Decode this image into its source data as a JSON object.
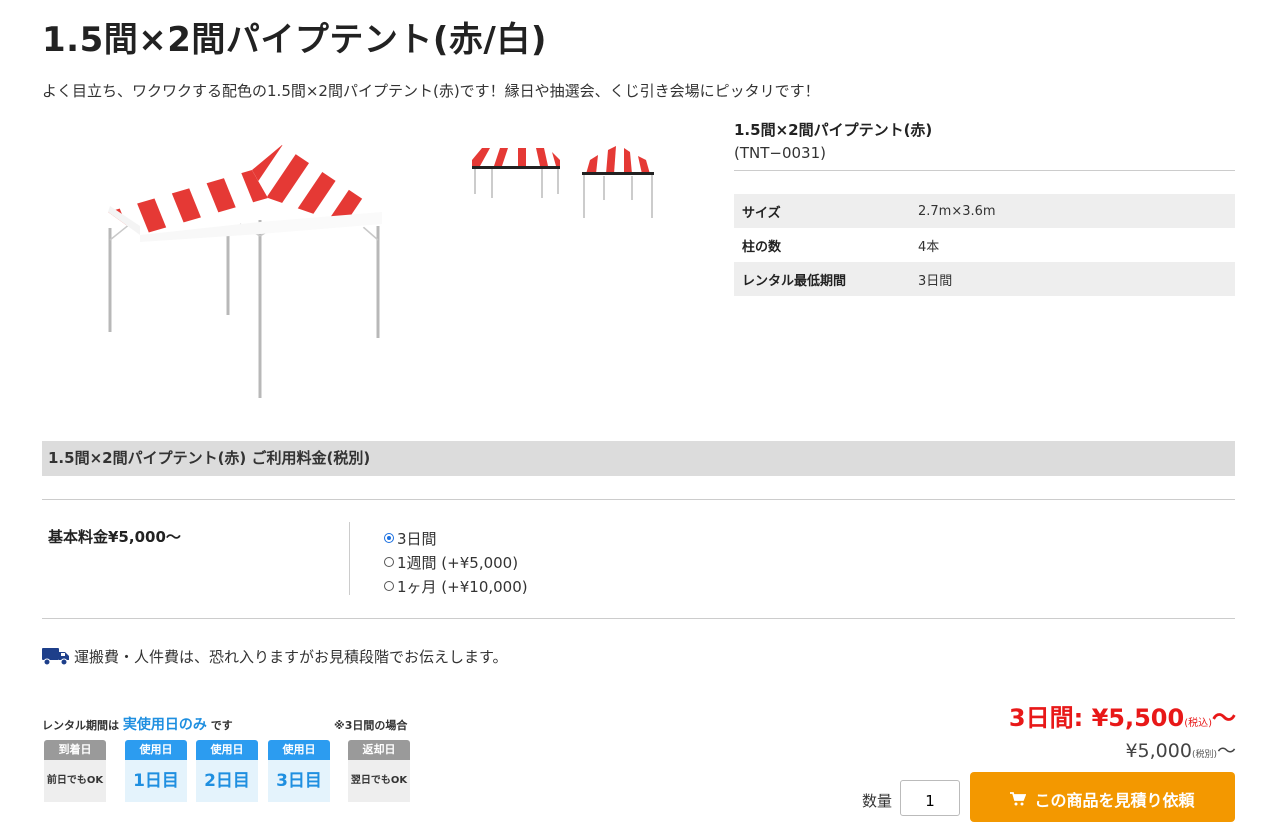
{
  "page": {
    "title": "1.5間×2間パイプテント(赤/白)",
    "lead": "よく目立ち、ワクワクする配色の1.5間×2間パイプテント(赤)です！縁日や抽選会、くじ引き会場にピッタリです！"
  },
  "product": {
    "name": "1.5間×2間パイプテント(赤)",
    "code": "(TNT−0031)",
    "specs": [
      {
        "key": "サイズ",
        "value": "2.7m×3.6m"
      },
      {
        "key": "柱の数",
        "value": "4本"
      },
      {
        "key": "レンタル最低期間",
        "value": "3日間"
      }
    ]
  },
  "pricing": {
    "header": "1.5間×2間パイプテント(赤) ご利用料金(税別)",
    "base_label": "基本料金¥5,000〜",
    "options": [
      {
        "label": "3日間",
        "selected": true
      },
      {
        "label": "1週間 (+¥5,000)",
        "selected": false
      },
      {
        "label": "1ヶ月 (+¥10,000)",
        "selected": false
      }
    ]
  },
  "shipping_note": "運搬費・人件費は、恐れ入りますがお見積段階でお伝えします。",
  "rental_banner": {
    "lead": "レンタル期間は",
    "highlight": "実使用日のみ",
    "tail": "です",
    "note": "※3日間の場合",
    "days": [
      {
        "top": "到着日",
        "bottom": "前日でもOK",
        "kind": "gray"
      },
      {
        "top": "使用日",
        "bottom": "1日目",
        "kind": "blue"
      },
      {
        "top": "使用日",
        "bottom": "2日目",
        "kind": "blue"
      },
      {
        "top": "使用日",
        "bottom": "3日目",
        "kind": "blue"
      },
      {
        "top": "返却日",
        "bottom": "翌日でもOK",
        "kind": "gray"
      }
    ]
  },
  "price_summary": {
    "tax_in_label": "3日間: ¥5,500",
    "tax_in_suffix": "(税込)",
    "tax_ex_label": "¥5,000",
    "tax_ex_suffix": "(税別)",
    "tilde": "〜"
  },
  "cart": {
    "qty_label": "数量",
    "qty_value": "1",
    "button_label": "この商品を見積り依頼"
  },
  "colors": {
    "accent_orange": "#f39800",
    "price_red": "#e81818",
    "day_blue": "#2c9cf0",
    "truck_navy": "#1e3f8a"
  }
}
